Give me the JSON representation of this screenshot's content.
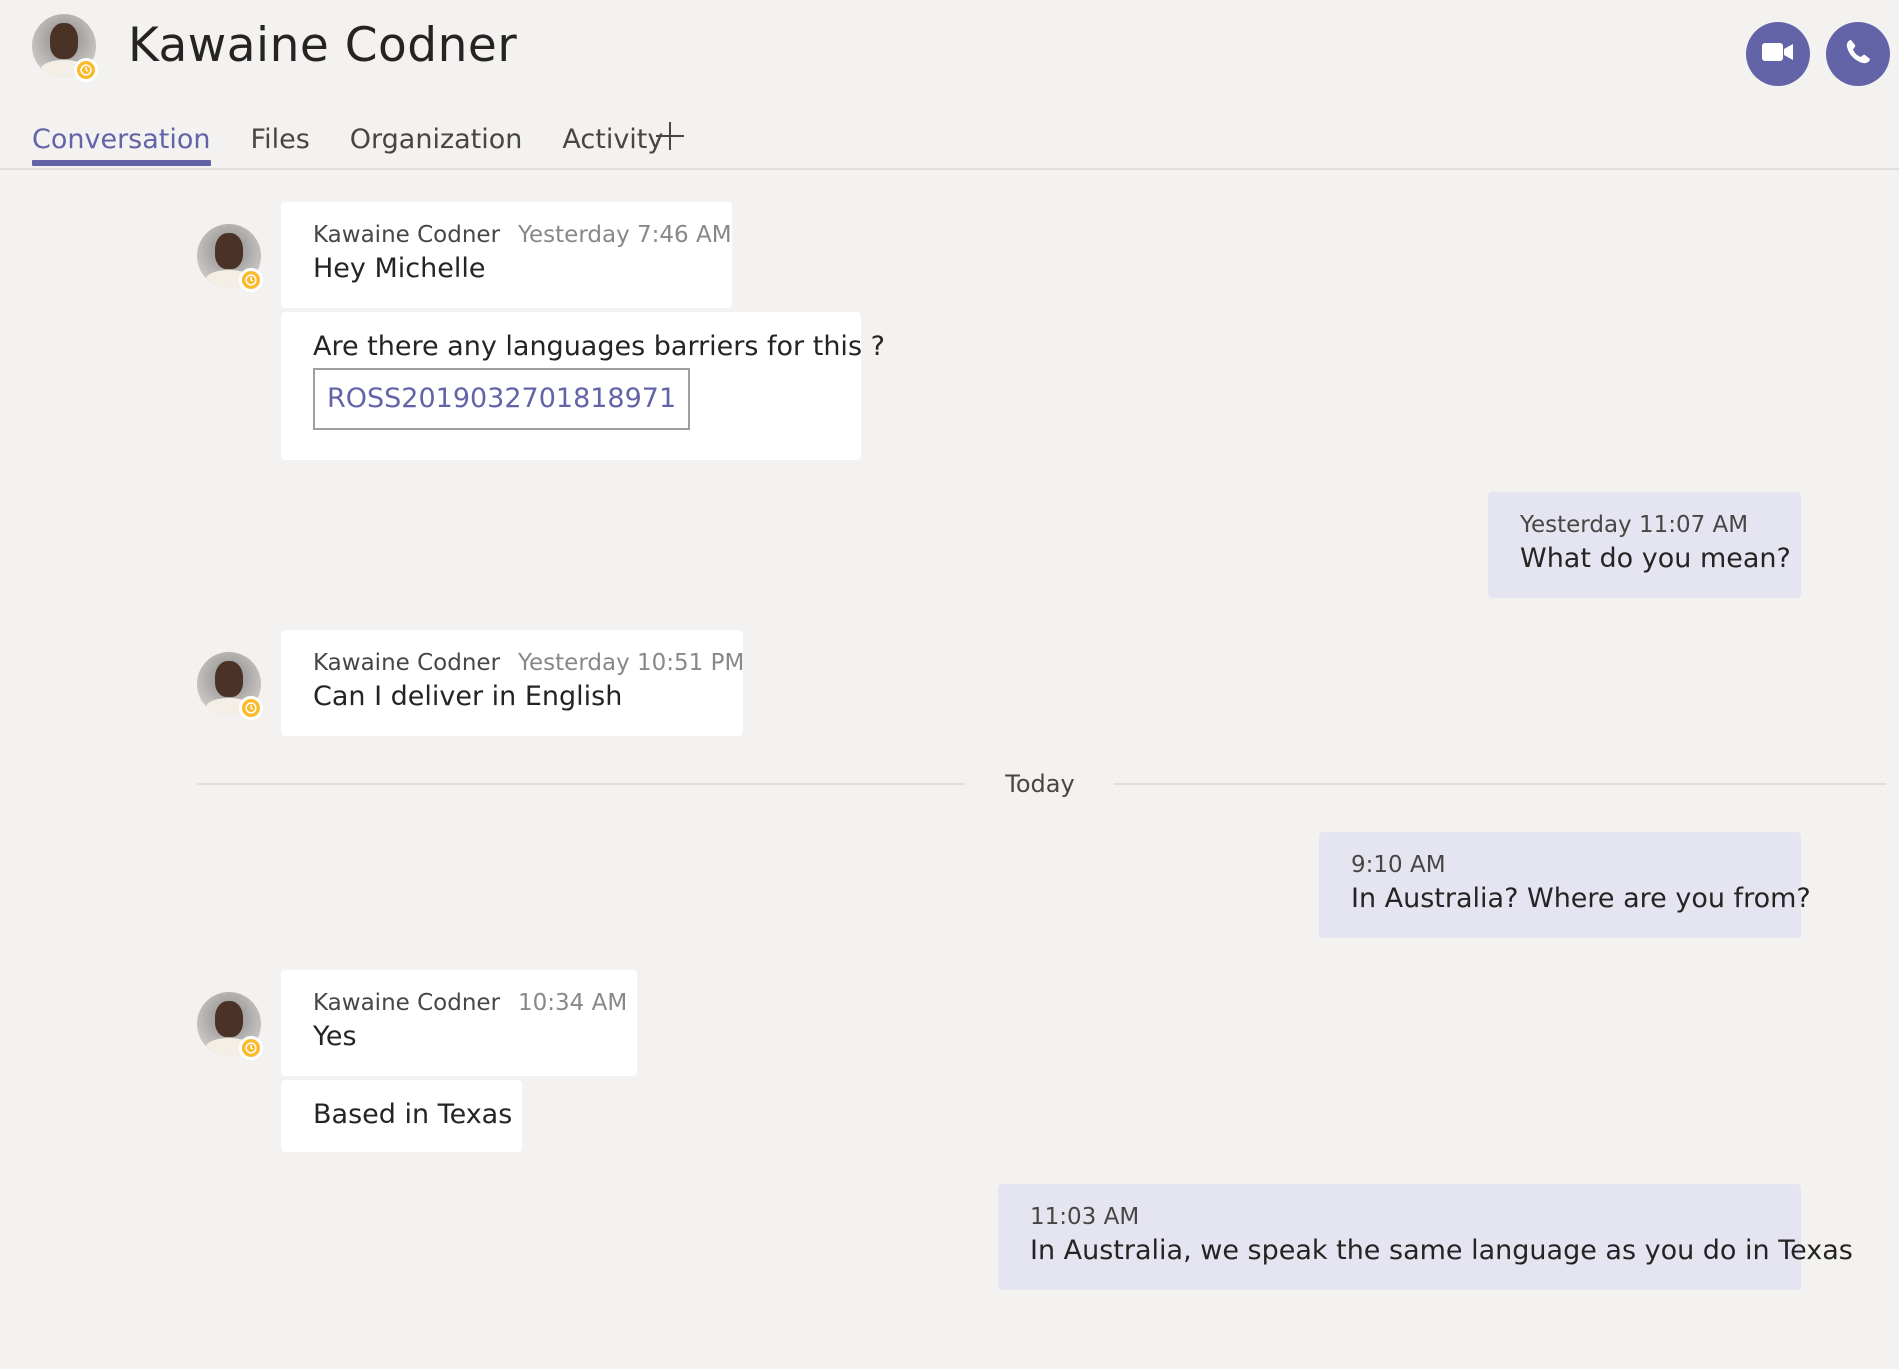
{
  "header": {
    "contact_name": "Kawaine Codner",
    "presence": "away",
    "video_call_icon": "video-camera-icon",
    "audio_call_icon": "phone-icon"
  },
  "tabs": [
    {
      "label": "Conversation",
      "active": true
    },
    {
      "label": "Files",
      "active": false
    },
    {
      "label": "Organization",
      "active": false
    },
    {
      "label": "Activity",
      "active": false
    }
  ],
  "add_tab_icon": "plus-icon",
  "messages": [
    {
      "author": "Kawaine Codner",
      "time": "Yesterday 7:46 AM",
      "text": "Hey Michelle"
    },
    {
      "text": "Are there any languages barriers for this ?",
      "reference": "ROSS2019032701818971"
    },
    {
      "time": "Yesterday 11:07 AM",
      "text": "What do you mean?"
    },
    {
      "author": "Kawaine Codner",
      "time": "Yesterday 10:51 PM",
      "text": "Can I deliver in English"
    },
    {
      "time": "9:10 AM",
      "text": "In Australia? Where are you from?"
    },
    {
      "author": "Kawaine Codner",
      "time": "10:34 AM",
      "text": "Yes"
    },
    {
      "text": "Based in Texas"
    },
    {
      "time": "11:03 AM",
      "text": "In Australia, we speak the same language as you do in Texas"
    }
  ],
  "divider": {
    "label": "Today"
  },
  "colors": {
    "accent": "#6264a7",
    "background": "#f3f2f1",
    "mine_bubble": "#e5e5f1",
    "presence_away": "#fcb92a"
  }
}
